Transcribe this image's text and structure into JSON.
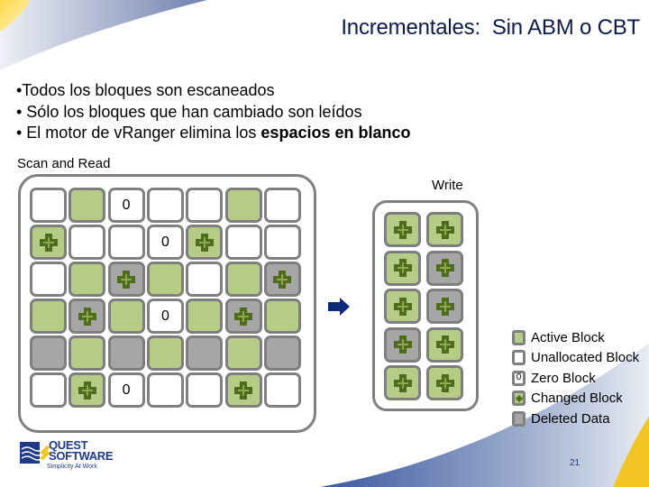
{
  "slide": {
    "title": "Incrementales:  Sin ABM o CBT",
    "bullets": [
      {
        "text": "•Todos los bloques son escaneados",
        "bold": ""
      },
      {
        "text": "• Sólo los bloques que han cambiado son leídos",
        "bold": ""
      },
      {
        "text": "• El motor de vRanger elimina los ",
        "bold": "espacios en blanco"
      }
    ],
    "page_number": "21"
  },
  "diagram": {
    "scan_label": "Scan and Read",
    "write_label": "Write",
    "zero_text": "0",
    "source_grid": [
      [
        "unallocated",
        "active",
        "zero",
        "unallocated",
        "unallocated",
        "active",
        "unallocated"
      ],
      [
        "changed",
        "unallocated",
        "unallocated",
        "zero",
        "changed",
        "unallocated",
        "unallocated"
      ],
      [
        "unallocated",
        "active",
        "deleted-changed",
        "active",
        "unallocated",
        "active",
        "deleted-changed"
      ],
      [
        "active",
        "deleted-changed",
        "active",
        "zero",
        "active",
        "deleted-changed",
        "active"
      ],
      [
        "deleted",
        "active",
        "deleted",
        "active",
        "deleted",
        "active",
        "deleted"
      ],
      [
        "unallocated",
        "changed",
        "zero",
        "unallocated",
        "unallocated",
        "changed",
        "unallocated"
      ]
    ],
    "target_grid": [
      [
        "changed",
        "changed"
      ],
      [
        "changed",
        "deleted-changed"
      ],
      [
        "changed",
        "deleted-changed"
      ],
      [
        "deleted-changed",
        "changed"
      ],
      [
        "changed",
        "changed"
      ]
    ],
    "arrow_icon": "right-arrow-icon"
  },
  "legend": {
    "items": [
      {
        "type": "active",
        "label": "Active Block"
      },
      {
        "type": "unallocated",
        "label": "Unallocated Block"
      },
      {
        "type": "zero",
        "label": "Zero Block",
        "glyph": "0"
      },
      {
        "type": "changed",
        "label": "Changed Block"
      },
      {
        "type": "deleted",
        "label": "Deleted Data"
      }
    ]
  },
  "logo": {
    "line1": "QUEST",
    "line2": "SOFTWARE",
    "tagline": "Simplicity At Work"
  },
  "colors": {
    "active": "#b5cc87",
    "deleted": "#a6a6a6",
    "border": "#808080",
    "plus_dark": "#4f6b1c",
    "plus_light": "#8fa84e",
    "arrow": "#0c2a7a",
    "title": "#0d1a4a"
  }
}
